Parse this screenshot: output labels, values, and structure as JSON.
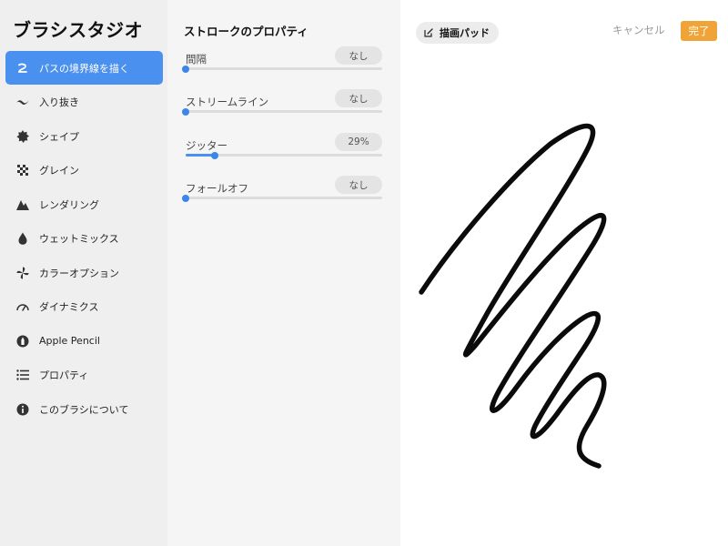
{
  "app": {
    "title": "ブラシスタジオ"
  },
  "sidebar": {
    "items": [
      {
        "label": "パスの境界線を描く",
        "icon": "stroke-path-icon",
        "active": true
      },
      {
        "label": "入り抜き",
        "icon": "taper-icon",
        "active": false
      },
      {
        "label": "シェイプ",
        "icon": "shape-icon",
        "active": false
      },
      {
        "label": "グレイン",
        "icon": "grain-icon",
        "active": false
      },
      {
        "label": "レンダリング",
        "icon": "rendering-icon",
        "active": false
      },
      {
        "label": "ウェットミックス",
        "icon": "wet-mix-icon",
        "active": false
      },
      {
        "label": "カラーオプション",
        "icon": "color-options-icon",
        "active": false
      },
      {
        "label": "ダイナミクス",
        "icon": "dynamics-icon",
        "active": false
      },
      {
        "label": "Apple Pencil",
        "icon": "apple-pencil-icon",
        "active": false
      },
      {
        "label": "プロパティ",
        "icon": "properties-icon",
        "active": false
      },
      {
        "label": "このブラシについて",
        "icon": "info-icon",
        "active": false
      }
    ]
  },
  "panel": {
    "title": "ストロークのプロパティ",
    "properties": [
      {
        "label": "間隔",
        "value": "なし",
        "level": 0
      },
      {
        "label": "ストリームライン",
        "value": "なし",
        "level": 0
      },
      {
        "label": "ジッター",
        "value": "29%",
        "level": 0.15
      },
      {
        "label": "フォールオフ",
        "value": "なし",
        "level": 0
      }
    ]
  },
  "canvas": {
    "pad_label": "描画パッド",
    "cancel_label": "キャンセル",
    "done_label": "完了"
  },
  "colors": {
    "accent": "#4a90ee",
    "done": "#f0a437",
    "sidebar_bg": "#efefef",
    "panel_bg": "#f5f5f5"
  }
}
